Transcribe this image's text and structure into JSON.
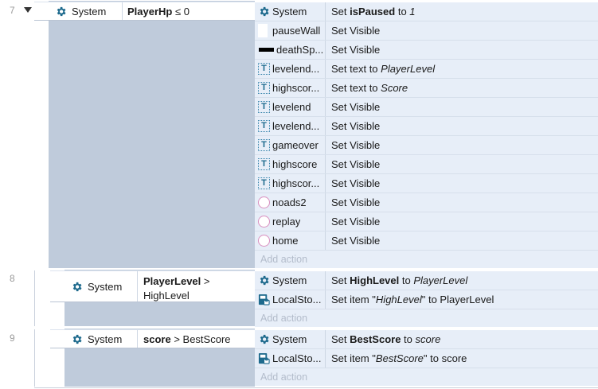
{
  "events": [
    {
      "number": "7",
      "condition": {
        "object": "System",
        "left": "PlayerHp",
        "op": "≤ 0",
        "right": ""
      },
      "actions": [
        {
          "icon": "gear-icon",
          "object": "System",
          "parts": [
            [
              "Set ",
              "n"
            ],
            [
              "isPaused",
              "b"
            ],
            [
              " to ",
              "n"
            ],
            [
              "1",
              "i"
            ]
          ]
        },
        {
          "icon": "white-square-icon",
          "object": "pauseWall",
          "parts": [
            [
              "Set Visible",
              "n"
            ]
          ]
        },
        {
          "icon": "black-bar-icon",
          "object": "deathSp...",
          "parts": [
            [
              "Set Visible",
              "n"
            ]
          ]
        },
        {
          "icon": "text-object-icon",
          "object": "levelend...",
          "parts": [
            [
              "Set text to ",
              "n"
            ],
            [
              "PlayerLevel",
              "i"
            ]
          ]
        },
        {
          "icon": "text-object-icon",
          "object": "highscor...",
          "parts": [
            [
              "Set text to ",
              "n"
            ],
            [
              "Score",
              "i"
            ]
          ]
        },
        {
          "icon": "text-object-icon",
          "object": "levelend",
          "parts": [
            [
              "Set Visible",
              "n"
            ]
          ]
        },
        {
          "icon": "text-object-icon",
          "object": "levelend...",
          "parts": [
            [
              "Set Visible",
              "n"
            ]
          ]
        },
        {
          "icon": "text-object-icon",
          "object": "gameover",
          "parts": [
            [
              "Set Visible",
              "n"
            ]
          ]
        },
        {
          "icon": "text-object-icon",
          "object": "highscore",
          "parts": [
            [
              "Set Visible",
              "n"
            ]
          ]
        },
        {
          "icon": "text-object-icon",
          "object": "highscor...",
          "parts": [
            [
              "Set Visible",
              "n"
            ]
          ]
        },
        {
          "icon": "circle-sprite-icon",
          "object": "noads2",
          "parts": [
            [
              "Set Visible",
              "n"
            ]
          ]
        },
        {
          "icon": "circle-sprite-icon",
          "object": "replay",
          "parts": [
            [
              "Set Visible",
              "n"
            ]
          ]
        },
        {
          "icon": "circle-sprite-icon",
          "object": "home",
          "parts": [
            [
              "Set Visible",
              "n"
            ]
          ]
        }
      ],
      "add_action": "Add action"
    },
    {
      "number": "8",
      "condition": {
        "object": "System",
        "left": "PlayerLevel",
        "op": ">",
        "right": "HighLevel"
      },
      "actions": [
        {
          "icon": "gear-icon",
          "object": "System",
          "parts": [
            [
              "Set ",
              "n"
            ],
            [
              "HighLevel",
              "b"
            ],
            [
              " to ",
              "n"
            ],
            [
              "PlayerLevel",
              "i"
            ]
          ]
        },
        {
          "icon": "local-storage-icon",
          "object": "LocalSto...",
          "parts": [
            [
              "Set item \"",
              "n"
            ],
            [
              "HighLevel",
              "i"
            ],
            [
              "\" to PlayerLevel",
              "n"
            ]
          ]
        }
      ],
      "add_action": "Add action"
    },
    {
      "number": "9",
      "condition": {
        "object": "System",
        "left": "score",
        "op": "> BestScore",
        "right": ""
      },
      "actions": [
        {
          "icon": "gear-icon",
          "object": "System",
          "parts": [
            [
              "Set ",
              "n"
            ],
            [
              "BestScore",
              "b"
            ],
            [
              " to ",
              "n"
            ],
            [
              "score",
              "i"
            ]
          ]
        },
        {
          "icon": "local-storage-icon",
          "object": "LocalSto...",
          "parts": [
            [
              "Set item \"",
              "n"
            ],
            [
              "BestScore",
              "i"
            ],
            [
              "\" to score",
              "n"
            ]
          ]
        }
      ],
      "add_action": "Add action"
    }
  ],
  "colors": {
    "event_bg": "#bfcbdb",
    "action_bg": "#e7eef8",
    "accent_icon": "#1e6a8d"
  }
}
